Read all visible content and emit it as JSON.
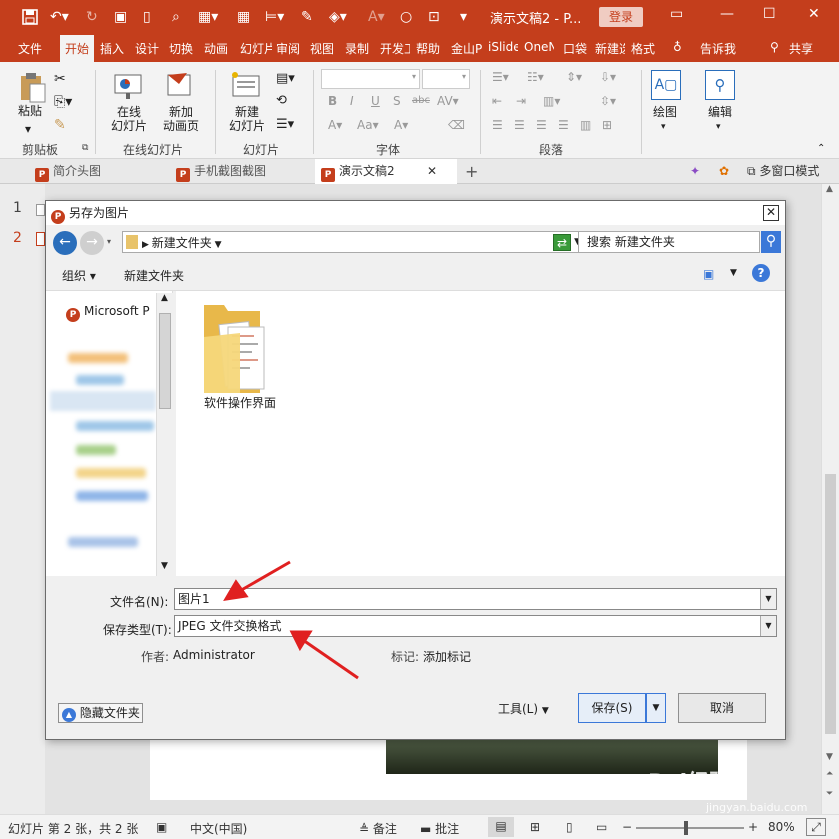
{
  "titlebar": {
    "title": "演示文稿2 - P...",
    "login": "登录",
    "autosave_icon": "save-icon"
  },
  "tabs": [
    "文件",
    "开始",
    "插入",
    "设计",
    "切换",
    "动画",
    "幻灯片",
    "审阅",
    "视图",
    "录制",
    "开发工",
    "帮助",
    "金山P",
    "iSlide",
    "OneN",
    "口袋",
    "新建选",
    "格式"
  ],
  "active_tab": "开始",
  "tell_me": "告诉我",
  "share": "共享",
  "ribbon": {
    "paste": "粘贴",
    "clipboard_group": "剪贴板",
    "online_slide": "在线\n幻灯片",
    "new_anim_page": "新加\n动画页",
    "online_group": "在线幻灯片",
    "new_slide": "新建\n幻灯片",
    "slides_group": "幻灯片",
    "font_group": "字体",
    "para_group": "段落",
    "drawing": "绘图",
    "editing": "编辑"
  },
  "doc_tabs": [
    {
      "label": "简介头图",
      "closable": false
    },
    {
      "label": "手机截图截图",
      "closable": false
    },
    {
      "label": "演示文稿2",
      "closable": true
    }
  ],
  "multi_window": "多窗口模式",
  "thumbs": [
    "1",
    "2"
  ],
  "dialog": {
    "title": "另存为图片",
    "breadcrumb": "新建文件夹",
    "search_placeholder": "搜索 新建文件夹",
    "organize": "组织",
    "new_folder": "新建文件夹",
    "nav_first": "Microsoft P",
    "folder_name": "软件操作界面",
    "filename_label": "文件名(N):",
    "filename_value": "图片1",
    "filetype_label": "保存类型(T):",
    "filetype_value": "JPEG 文件交换格式",
    "author_label": "作者:",
    "author_value": "Administrator",
    "tags_label": "标记:",
    "tags_value": "添加标记",
    "hide_folders": "隐藏文件夹",
    "tools": "工具(L)",
    "save": "保存(S)",
    "cancel": "取消"
  },
  "status": {
    "slide_info": "幻灯片 第 2 张，共 2 张",
    "language": "中文(中国)",
    "notes": "备注",
    "comments": "批注",
    "zoom": "80%"
  },
  "watermark": {
    "brand": "Bai经验",
    "url": "jingyan.baidu.com"
  },
  "colors": {
    "accent": "#c43e1c",
    "arrow": "#e02020"
  }
}
